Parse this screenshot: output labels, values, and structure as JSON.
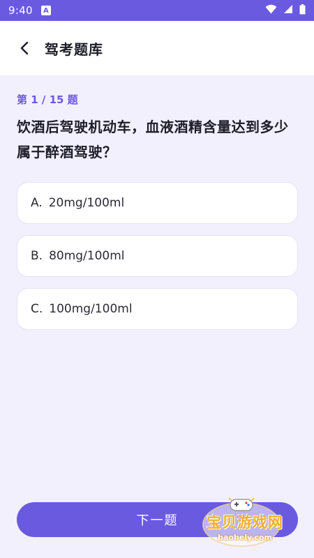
{
  "status_bar": {
    "time": "9:40",
    "app_icon_letter": "A",
    "icons": [
      "wifi-icon",
      "signal-icon",
      "battery-icon"
    ]
  },
  "header": {
    "back_icon": "chevron-left-icon",
    "title": "驾考题库"
  },
  "quiz": {
    "progress": "第 1 / 15 题",
    "question": "饮酒后驾驶机动车，血液酒精含量达到多少属于醉酒驾驶？",
    "options": [
      {
        "key": "A.",
        "text": "20mg/100ml"
      },
      {
        "key": "B.",
        "text": "80mg/100ml"
      },
      {
        "key": "C.",
        "text": "100mg/100ml"
      }
    ]
  },
  "footer": {
    "next_label": "下一题"
  },
  "watermark": {
    "text": "宝贝游戏网",
    "url": "baobely.com"
  },
  "colors": {
    "accent": "#6a5ae0",
    "background": "#f3f0fd",
    "card": "#ffffff",
    "text": "#1d1d2a"
  }
}
